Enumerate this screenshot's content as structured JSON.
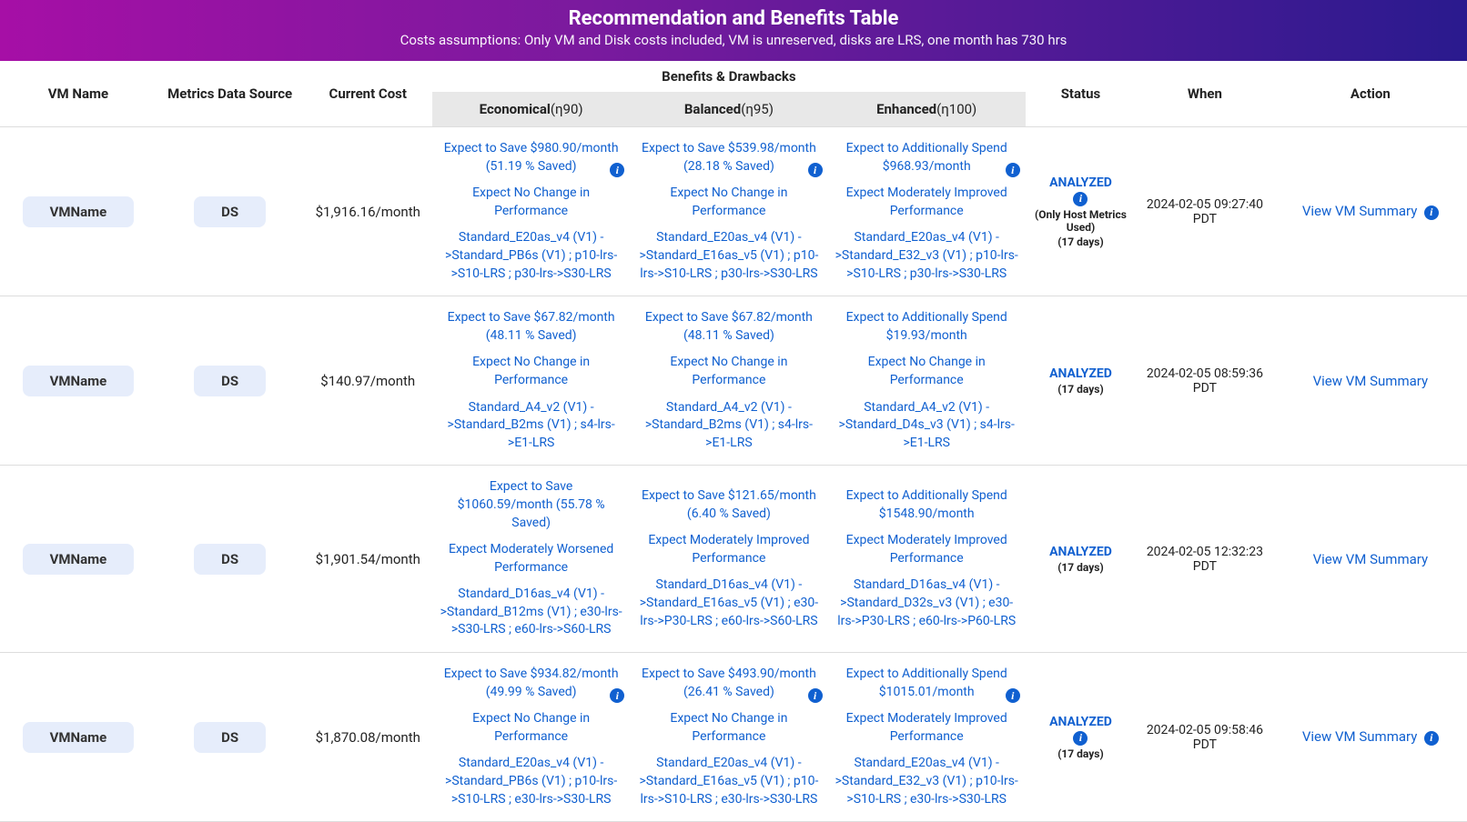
{
  "header": {
    "title": "Recommendation and Benefits Table",
    "subtitle": "Costs assumptions: Only VM and Disk costs included, VM is unreserved, disks are LRS, one month has 730 hrs"
  },
  "columns": {
    "vm": "VM Name",
    "ds": "Metrics Data Source",
    "cost": "Current Cost",
    "benefits": "Benefits & Drawbacks",
    "economical": "Economical",
    "economical_eta": "(η90)",
    "balanced": "Balanced",
    "balanced_eta": "(η95)",
    "enhanced": "Enhanced",
    "enhanced_eta": "(η100)",
    "status": "Status",
    "when": "When",
    "action": "Action"
  },
  "labels": {
    "info": "i",
    "view_summary": "View VM Summary"
  },
  "rows": [
    {
      "vm": "VMName",
      "ds": "DS",
      "cost": "$1,916.16/month",
      "econ": {
        "save": "Expect to Save $980.90/month (51.19 % Saved)",
        "perf": "Expect No Change in Performance",
        "plan": "Standard_E20as_v4 (V1) ->Standard_PB6s (V1) ; p10-lrs->S10-LRS ; p30-lrs->S30-LRS",
        "info": true
      },
      "bal": {
        "save": "Expect to Save $539.98/month (28.18 % Saved)",
        "perf": "Expect No Change in Performance",
        "plan": "Standard_E20as_v4 (V1) ->Standard_E16as_v5 (V1) ; p10-lrs->S10-LRS ; p30-lrs->S30-LRS",
        "info": true
      },
      "enh": {
        "save": "Expect to Additionally Spend $968.93/month",
        "perf": "Expect Moderately Improved Performance",
        "plan": "Standard_E20as_v4 (V1) ->Standard_E32_v3 (V1) ; p10-lrs->S10-LRS ; p30-lrs->S30-LRS",
        "info": true
      },
      "status": "ANALYZED",
      "status_info": true,
      "status_note": "(Only Host Metrics Used)",
      "status_days": "(17 days)",
      "when": "2024-02-05 09:27:40 PDT",
      "action_info": true
    },
    {
      "vm": "VMName",
      "ds": "DS",
      "cost": "$140.97/month",
      "econ": {
        "save": "Expect to Save $67.82/month (48.11 % Saved)",
        "perf": "Expect No Change in Performance",
        "plan": "Standard_A4_v2 (V1) ->Standard_B2ms (V1) ; s4-lrs->E1-LRS",
        "info": false
      },
      "bal": {
        "save": "Expect to Save $67.82/month (48.11 % Saved)",
        "perf": "Expect No Change in Performance",
        "plan": "Standard_A4_v2 (V1) ->Standard_B2ms (V1) ; s4-lrs->E1-LRS",
        "info": false
      },
      "enh": {
        "save": "Expect to Additionally Spend $19.93/month",
        "perf": "Expect No Change in Performance",
        "plan": "Standard_A4_v2 (V1) ->Standard_D4s_v3 (V1) ; s4-lrs->E1-LRS",
        "info": false
      },
      "status": "ANALYZED",
      "status_info": false,
      "status_note": "",
      "status_days": "(17 days)",
      "when": "2024-02-05 08:59:36 PDT",
      "action_info": false
    },
    {
      "vm": "VMName",
      "ds": "DS",
      "cost": "$1,901.54/month",
      "econ": {
        "save": "Expect to Save $1060.59/month (55.78 % Saved)",
        "perf": "Expect Moderately Worsened Performance",
        "plan": "Standard_D16as_v4 (V1) ->Standard_B12ms (V1) ; e30-lrs->S30-LRS ; e60-lrs->S60-LRS",
        "info": false
      },
      "bal": {
        "save": "Expect to Save $121.65/month (6.40 % Saved)",
        "perf": "Expect Moderately Improved Performance",
        "plan": "Standard_D16as_v4 (V1) ->Standard_E16as_v5 (V1) ; e30-lrs->P30-LRS ; e60-lrs->S60-LRS",
        "info": false
      },
      "enh": {
        "save": "Expect to Additionally Spend $1548.90/month",
        "perf": "Expect Moderately Improved Performance",
        "plan": "Standard_D16as_v4 (V1) ->Standard_D32s_v3 (V1) ; e30-lrs->P30-LRS ; e60-lrs->P60-LRS",
        "info": false
      },
      "status": "ANALYZED",
      "status_info": false,
      "status_note": "",
      "status_days": "(17 days)",
      "when": "2024-02-05 12:32:23 PDT",
      "action_info": false
    },
    {
      "vm": "VMName",
      "ds": "DS",
      "cost": "$1,870.08/month",
      "econ": {
        "save": "Expect to Save $934.82/month (49.99 % Saved)",
        "perf": "Expect No Change in Performance",
        "plan": "Standard_E20as_v4 (V1) ->Standard_PB6s (V1) ; p10-lrs->S10-LRS ; e30-lrs->S30-LRS",
        "info": true
      },
      "bal": {
        "save": "Expect to Save $493.90/month (26.41 % Saved)",
        "perf": "Expect No Change in Performance",
        "plan": "Standard_E20as_v4 (V1) ->Standard_E16as_v5 (V1) ; p10-lrs->S10-LRS ; e30-lrs->S30-LRS",
        "info": true
      },
      "enh": {
        "save": "Expect to Additionally Spend $1015.01/month",
        "perf": "Expect Moderately Improved Performance",
        "plan": "Standard_E20as_v4 (V1) ->Standard_E32_v3 (V1) ; p10-lrs->S10-LRS ; e30-lrs->S30-LRS",
        "info": true
      },
      "status": "ANALYZED",
      "status_info": true,
      "status_note": "",
      "status_days": "(17 days)",
      "when": "2024-02-05 09:58:46 PDT",
      "action_info": true
    }
  ]
}
